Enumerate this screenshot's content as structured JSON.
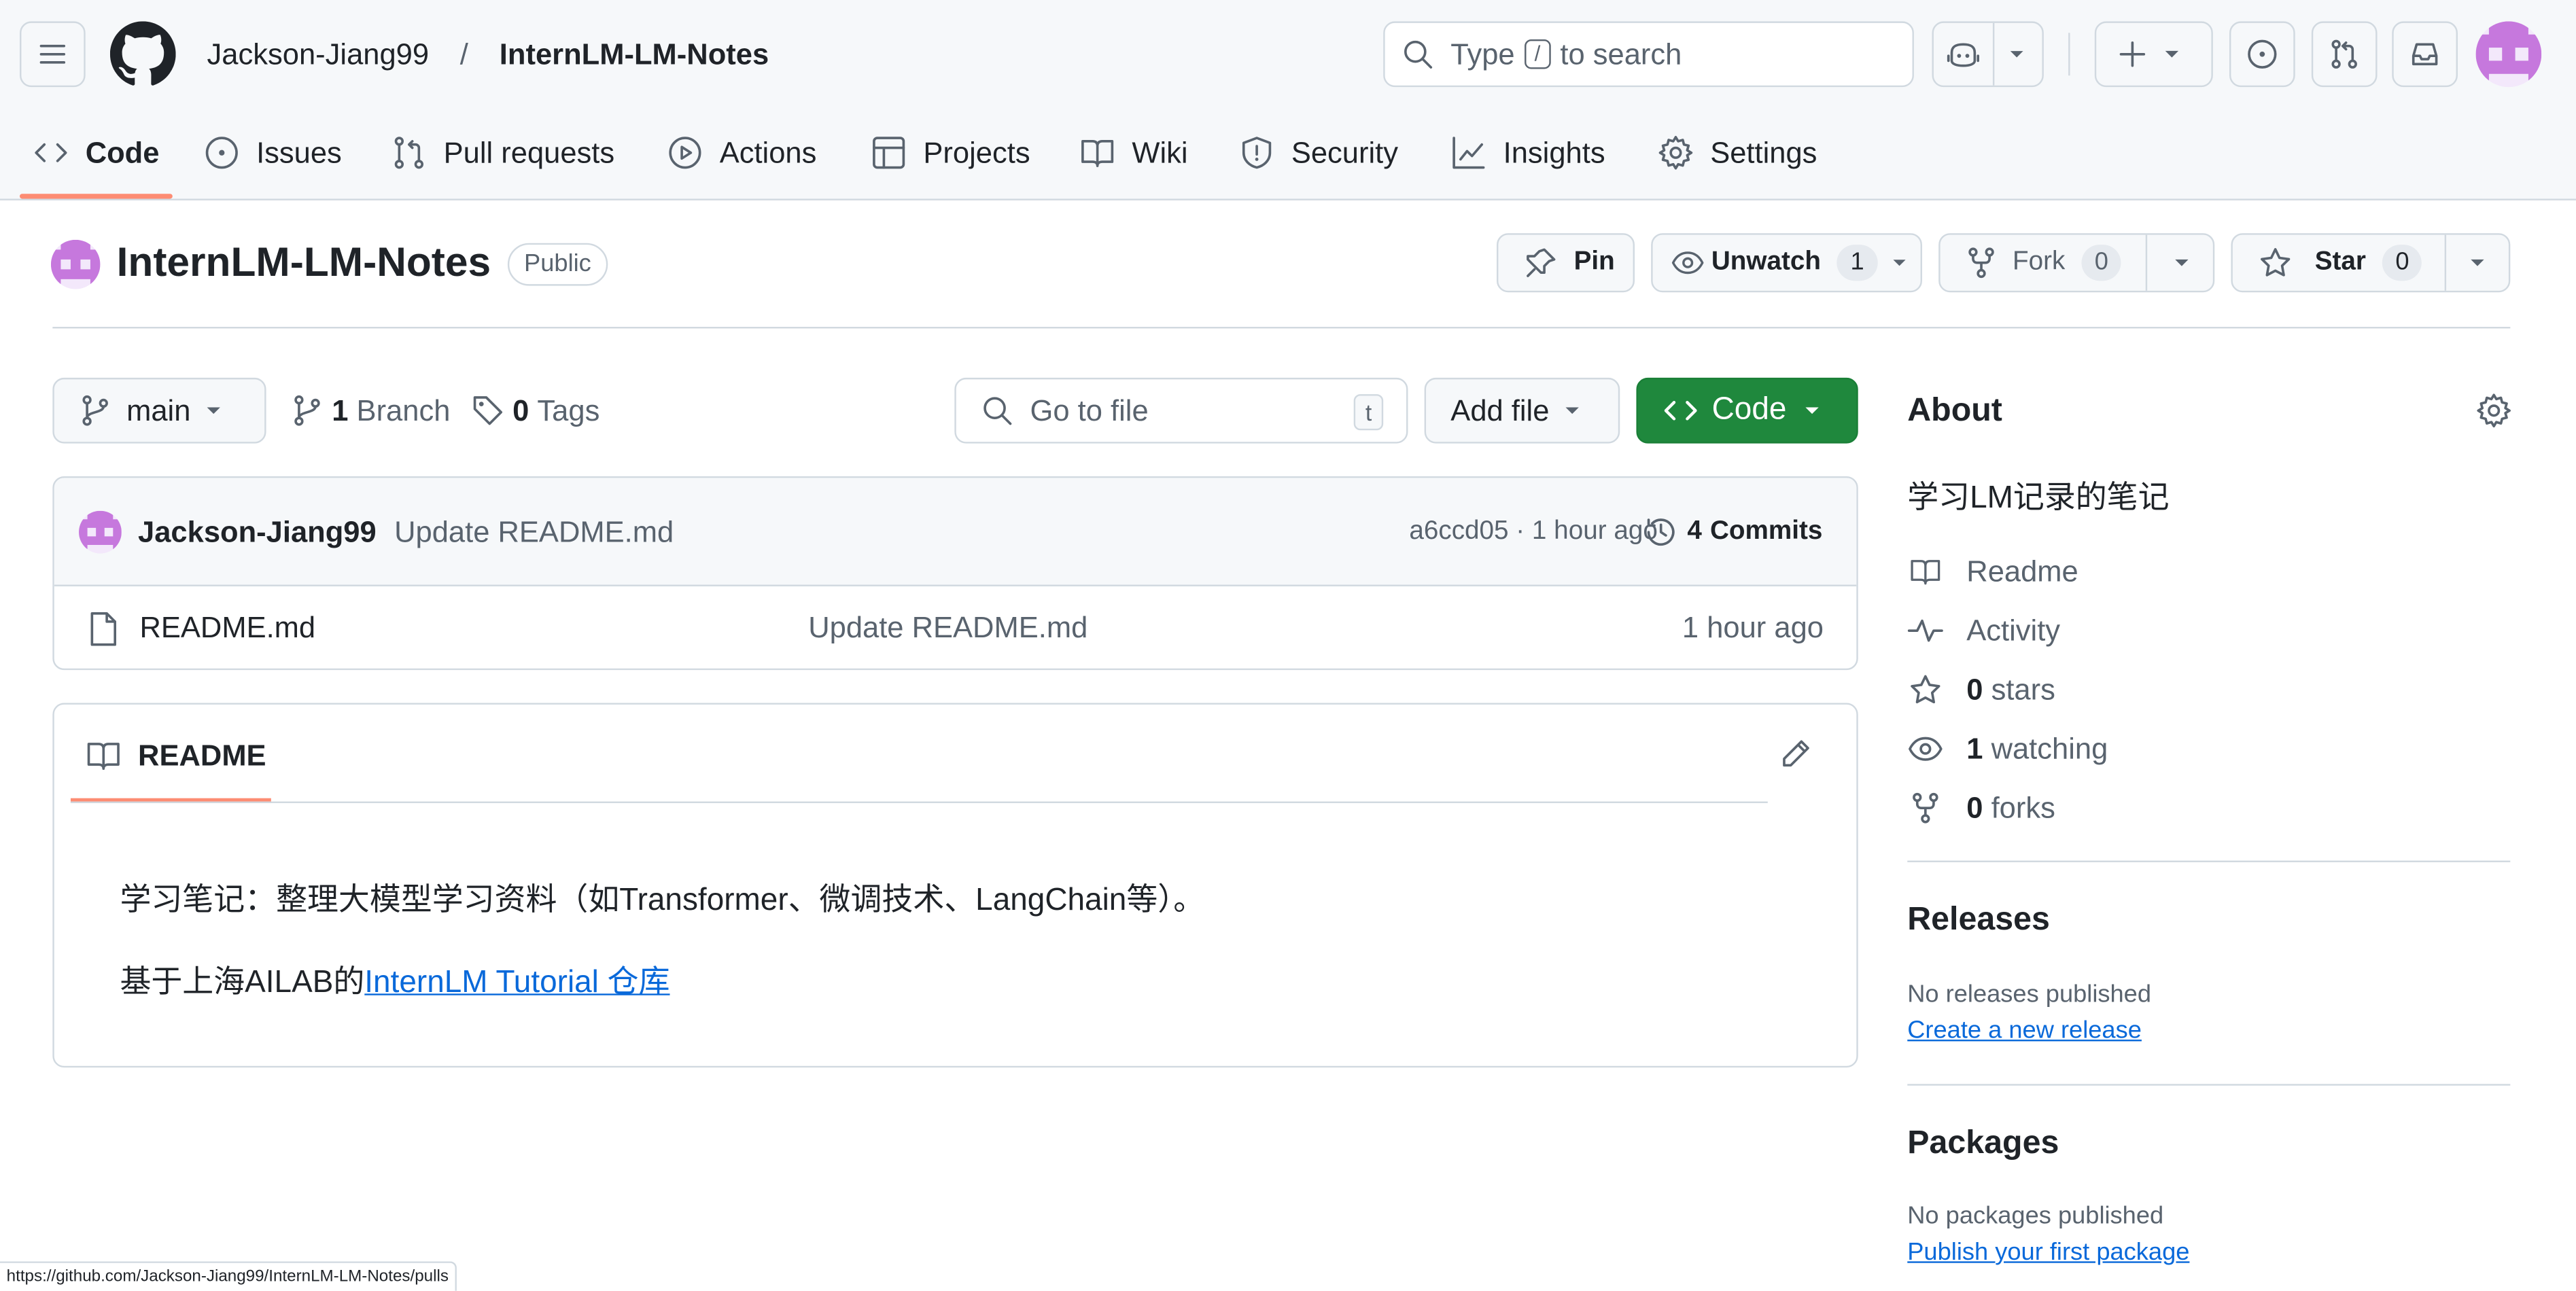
{
  "header": {
    "owner": "Jackson-Jiang99",
    "separator": "/",
    "repo": "InternLM-LM-Notes",
    "search_pre": "Type",
    "search_key": "/",
    "search_post": "to search"
  },
  "tabs": [
    {
      "label": "Code",
      "icon": "code-icon"
    },
    {
      "label": "Issues",
      "icon": "issue-icon"
    },
    {
      "label": "Pull requests",
      "icon": "pull-request-icon"
    },
    {
      "label": "Actions",
      "icon": "play-icon"
    },
    {
      "label": "Projects",
      "icon": "table-icon"
    },
    {
      "label": "Wiki",
      "icon": "book-icon"
    },
    {
      "label": "Security",
      "icon": "shield-icon"
    },
    {
      "label": "Insights",
      "icon": "graph-icon"
    },
    {
      "label": "Settings",
      "icon": "gear-icon"
    }
  ],
  "repo_header": {
    "title": "InternLM-LM-Notes",
    "visibility": "Public",
    "pin_label": "Pin",
    "unwatch_label": "Unwatch",
    "watch_count": "1",
    "fork_label": "Fork",
    "fork_count": "0",
    "star_label": "Star",
    "star_count": "0"
  },
  "toolbar": {
    "branch": "main",
    "branch_count": "1",
    "branch_label": "Branch",
    "tag_count": "0",
    "tag_label": "Tags",
    "goto_placeholder": "Go to file",
    "goto_key": "t",
    "add_file": "Add file",
    "code": "Code"
  },
  "latest_commit": {
    "author": "Jackson-Jiang99",
    "message": "Update README.md",
    "hash_time": "a6ccd05 · 1 hour ago",
    "commits_count": "4",
    "commits_label": "Commits"
  },
  "files": [
    {
      "name": "README.md",
      "message": "Update README.md",
      "time": "1 hour ago"
    }
  ],
  "readme": {
    "tab_label": "README",
    "line1": "学习笔记：整理大模型学习资料（如Transformer、微调技术、LangChain等）。",
    "line2_prefix": "基于上海AILAB的",
    "line2_link": "InternLM Tutorial 仓库"
  },
  "about": {
    "heading": "About",
    "description": "学习LM记录的笔记",
    "readme": "Readme",
    "activity": "Activity",
    "stars_count": "0",
    "stars_label": "stars",
    "watching_count": "1",
    "watching_label": "watching",
    "forks_count": "0",
    "forks_label": "forks"
  },
  "releases": {
    "heading": "Releases",
    "empty": "No releases published",
    "link": "Create a new release"
  },
  "packages": {
    "heading": "Packages",
    "empty": "No packages published",
    "link": "Publish your first package"
  },
  "status_url": "https://github.com/Jackson-Jiang99/InternLM-LM-Notes/pulls",
  "colors": {
    "accent_green": "#1f883d",
    "link_blue": "#0969da",
    "tab_underline": "#fd8c73",
    "avatar_purple": "#c678dd"
  }
}
